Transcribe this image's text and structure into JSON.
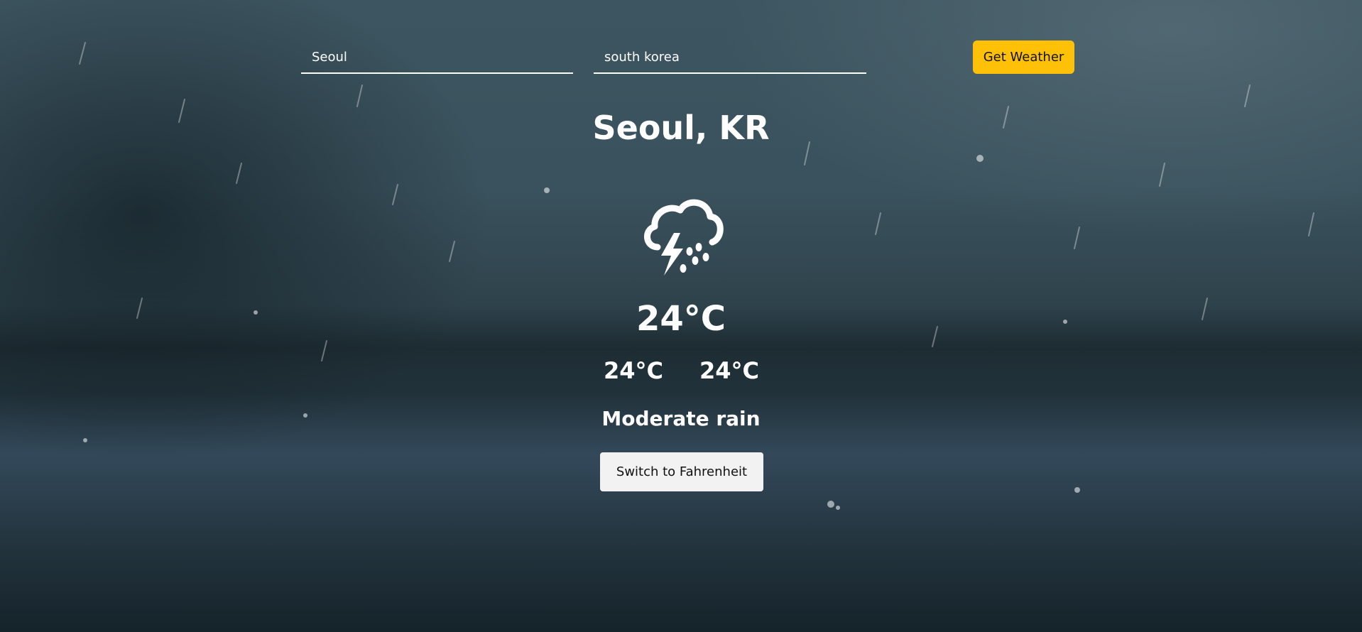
{
  "search": {
    "city_value": "Seoul",
    "country_value": "south korea",
    "button_label": "Get Weather"
  },
  "weather": {
    "location": "Seoul, KR",
    "icon": "thunderstorm-rain-icon",
    "temperature": "24°C",
    "temp_min": "24°C",
    "temp_max": "24°C",
    "description": "Moderate rain"
  },
  "actions": {
    "switch_unit_label": "Switch to Fahrenheit"
  },
  "colors": {
    "accent": "#ffc107",
    "text": "#ffffff",
    "secondary_button": "#f2f2f2"
  }
}
